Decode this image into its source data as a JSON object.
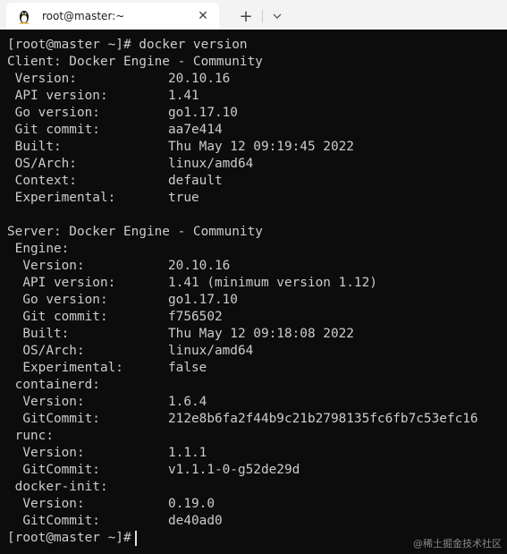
{
  "tab": {
    "title": "root@master:~",
    "close": "✕"
  },
  "toolbar": {
    "new_tab": "+"
  },
  "lines": [
    {
      "k": "[root@master ~]# docker version",
      "v": ""
    },
    {
      "k": "Client: Docker Engine - Community",
      "v": ""
    },
    {
      "k": " Version:",
      "v": "20.10.16"
    },
    {
      "k": " API version:",
      "v": "1.41"
    },
    {
      "k": " Go version:",
      "v": "go1.17.10"
    },
    {
      "k": " Git commit:",
      "v": "aa7e414"
    },
    {
      "k": " Built:",
      "v": "Thu May 12 09:19:45 2022"
    },
    {
      "k": " OS/Arch:",
      "v": "linux/amd64"
    },
    {
      "k": " Context:",
      "v": "default"
    },
    {
      "k": " Experimental:",
      "v": "true"
    },
    {
      "k": "",
      "v": ""
    },
    {
      "k": "Server: Docker Engine - Community",
      "v": ""
    },
    {
      "k": " Engine:",
      "v": ""
    },
    {
      "k": "  Version:",
      "v": "20.10.16"
    },
    {
      "k": "  API version:",
      "v": "1.41 (minimum version 1.12)"
    },
    {
      "k": "  Go version:",
      "v": "go1.17.10"
    },
    {
      "k": "  Git commit:",
      "v": "f756502"
    },
    {
      "k": "  Built:",
      "v": "Thu May 12 09:18:08 2022"
    },
    {
      "k": "  OS/Arch:",
      "v": "linux/amd64"
    },
    {
      "k": "  Experimental:",
      "v": "false"
    },
    {
      "k": " containerd:",
      "v": ""
    },
    {
      "k": "  Version:",
      "v": "1.6.4"
    },
    {
      "k": "  GitCommit:",
      "v": "212e8b6fa2f44b9c21b2798135fc6fb7c53efc16"
    },
    {
      "k": " runc:",
      "v": ""
    },
    {
      "k": "  Version:",
      "v": "1.1.1"
    },
    {
      "k": "  GitCommit:",
      "v": "v1.1.1-0-g52de29d"
    },
    {
      "k": " docker-init:",
      "v": ""
    },
    {
      "k": "  Version:",
      "v": "0.19.0"
    },
    {
      "k": "  GitCommit:",
      "v": "de40ad0"
    }
  ],
  "prompt": "[root@master ~]#",
  "watermark": "@稀土掘金技术社区",
  "colors": {
    "background": "#0c0c0c",
    "text": "#cccccc",
    "tabbar": "#f3f3f3"
  }
}
